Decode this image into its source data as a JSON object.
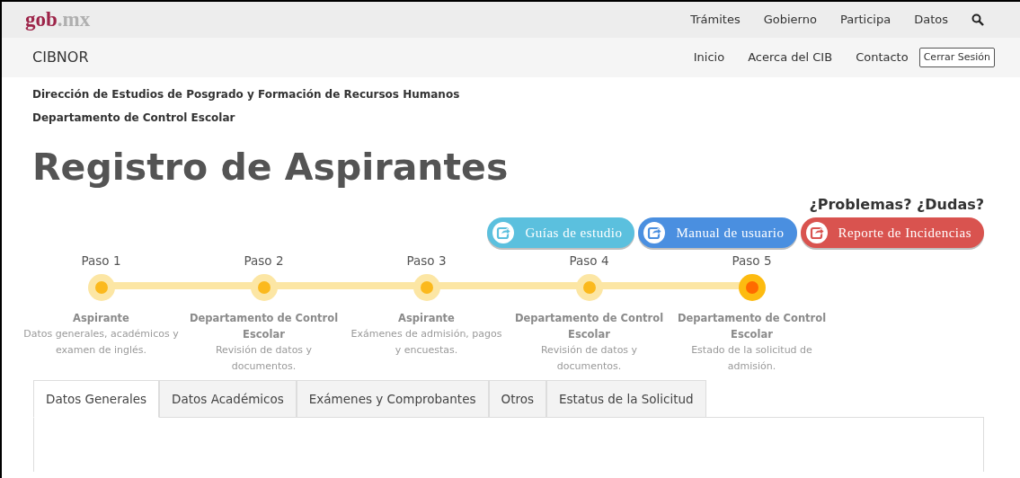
{
  "top_nav": {
    "logo": {
      "text": "gob",
      "suffix": ".mx"
    },
    "links": [
      "Trámites",
      "Gobierno",
      "Participa",
      "Datos"
    ]
  },
  "sub_nav": {
    "title": "CIBNOR",
    "links": [
      "Inicio",
      "Acerca del CIB",
      "Contacto"
    ],
    "logout": "Cerrar Sesión"
  },
  "headings": [
    "Dirección de Estudios de Posgrado y Formación de Recursos Humanos",
    "Departamento de Control Escolar"
  ],
  "page_title": "Registro de Aspirantes",
  "help_title": "¿Problemas? ¿Dudas?",
  "help_buttons": [
    {
      "label": "Guías de estudio",
      "color": "#5bc0de"
    },
    {
      "label": "Manual de usuario",
      "color": "#4a8fe0"
    },
    {
      "label": "Reporte de Incidencias",
      "color": "#d9534f"
    }
  ],
  "steps": [
    {
      "label": "Paso 1",
      "actor": "Aspirante",
      "description": "Datos generales, académicos y examen de inglés.",
      "current": false
    },
    {
      "label": "Paso 2",
      "actor": "Departamento de Control Escolar",
      "description": "Revisión de datos y documentos.",
      "current": false
    },
    {
      "label": "Paso 3",
      "actor": "Aspirante",
      "description": "Exámenes de admisión, pagos y encuestas.",
      "current": false
    },
    {
      "label": "Paso 4",
      "actor": "Departamento de Control Escolar",
      "description": "Revisión de datos y documentos.",
      "current": false
    },
    {
      "label": "Paso 5",
      "actor": "Departamento de Control Escolar",
      "description": "Estado de la solicitud de admisión.",
      "current": true
    }
  ],
  "tabs": [
    {
      "label": "Datos Generales",
      "selected": true
    },
    {
      "label": "Datos Académicos",
      "selected": false
    },
    {
      "label": "Exámenes y Comprobantes",
      "selected": false
    },
    {
      "label": "Otros",
      "selected": false
    },
    {
      "label": "Estatus de la Solicitud",
      "selected": false
    }
  ]
}
